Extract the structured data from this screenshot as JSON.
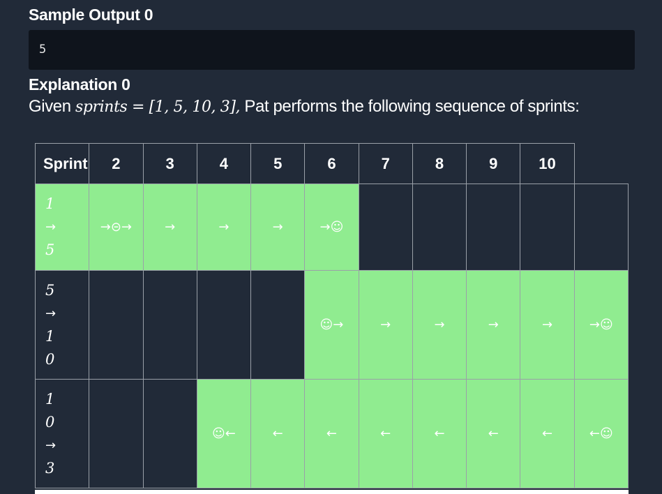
{
  "sample_output": {
    "title": "Sample Output 0",
    "value": "5"
  },
  "explanation": {
    "title": "Explanation 0",
    "text_prefix": "Given ",
    "math": "sprints = [1, 5, 10, 3],",
    "text_suffix": " Pat performs the following sequence of sprints:"
  },
  "table": {
    "headers": [
      "Sprint",
      "2",
      "3",
      "4",
      "5",
      "6",
      "7",
      "8",
      "9",
      "10"
    ],
    "rows": [
      {
        "label": [
          "1",
          "→",
          "5"
        ],
        "cells": [
          {
            "mark": "→⊝→",
            "fill": "green"
          },
          {
            "mark": "→",
            "fill": "green"
          },
          {
            "mark": "→",
            "fill": "green"
          },
          {
            "mark": "→",
            "fill": "green"
          },
          {
            "mark": "→☺",
            "fill": "green"
          },
          {
            "mark": "",
            "fill": "dark"
          },
          {
            "mark": "",
            "fill": "dark"
          },
          {
            "mark": "",
            "fill": "dark"
          },
          {
            "mark": "",
            "fill": "dark"
          },
          {
            "mark": "",
            "fill": "dark"
          }
        ]
      },
      {
        "label": [
          "5",
          "→",
          "1",
          "0"
        ],
        "cells": [
          {
            "mark": "",
            "fill": "dark"
          },
          {
            "mark": "",
            "fill": "dark"
          },
          {
            "mark": "",
            "fill": "dark"
          },
          {
            "mark": "",
            "fill": "dark"
          },
          {
            "mark": "☺→",
            "fill": "green"
          },
          {
            "mark": "→",
            "fill": "green"
          },
          {
            "mark": "→",
            "fill": "green"
          },
          {
            "mark": "→",
            "fill": "green"
          },
          {
            "mark": "→",
            "fill": "green"
          },
          {
            "mark": "→☺",
            "fill": "green"
          }
        ]
      },
      {
        "label": [
          "1",
          "0",
          "→",
          "3"
        ],
        "cells": [
          {
            "mark": "",
            "fill": "dark"
          },
          {
            "mark": "",
            "fill": "dark"
          },
          {
            "mark": "☺←",
            "fill": "green"
          },
          {
            "mark": "←",
            "fill": "green"
          },
          {
            "mark": "←",
            "fill": "green"
          },
          {
            "mark": "←",
            "fill": "green"
          },
          {
            "mark": "←",
            "fill": "green"
          },
          {
            "mark": "←",
            "fill": "green"
          },
          {
            "mark": "←",
            "fill": "green"
          },
          {
            "mark": "←☺",
            "fill": "green"
          }
        ]
      }
    ]
  },
  "colors": {
    "background": "#212a38",
    "output_box": "#0f141c",
    "highlight": "#90ec90",
    "grid_line": "#9aa0a8"
  }
}
